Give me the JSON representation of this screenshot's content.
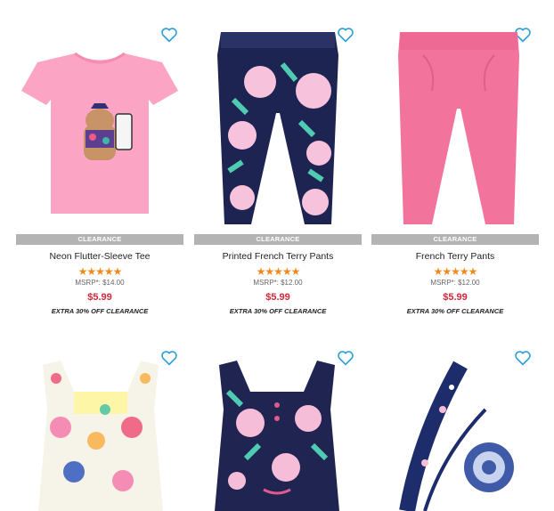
{
  "colors": {
    "accent_blue": "#2f9fd8",
    "clearance_gray": "#b3b3b3",
    "price_red": "#d3283a",
    "star_orange": "#f08a1e"
  },
  "products": [
    {
      "name": "Neon Flutter-Sleeve Tee",
      "badge": "CLEARANCE",
      "stars": "★★★★★",
      "rating": 5,
      "msrp": "MSRP*: $14.00",
      "price": "$5.99",
      "promo": "EXTRA 30% OFF CLEARANCE",
      "favorite_icon": "heart-outline-icon"
    },
    {
      "name": "Printed French Terry Pants",
      "badge": "CLEARANCE",
      "stars": "★★★★★",
      "rating": 5,
      "msrp": "MSRP*: $12.00",
      "price": "$5.99",
      "promo": "EXTRA 30% OFF CLEARANCE",
      "favorite_icon": "heart-outline-icon"
    },
    {
      "name": "French Terry Pants",
      "badge": "CLEARANCE",
      "stars": "★★★★★",
      "rating": 5,
      "msrp": "MSRP*: $12.00",
      "price": "$5.99",
      "promo": "EXTRA 30% OFF CLEARANCE",
      "favorite_icon": "heart-outline-icon"
    },
    {
      "favorite_icon": "heart-outline-icon"
    },
    {
      "favorite_icon": "heart-outline-icon"
    },
    {
      "favorite_icon": "heart-outline-icon"
    }
  ]
}
